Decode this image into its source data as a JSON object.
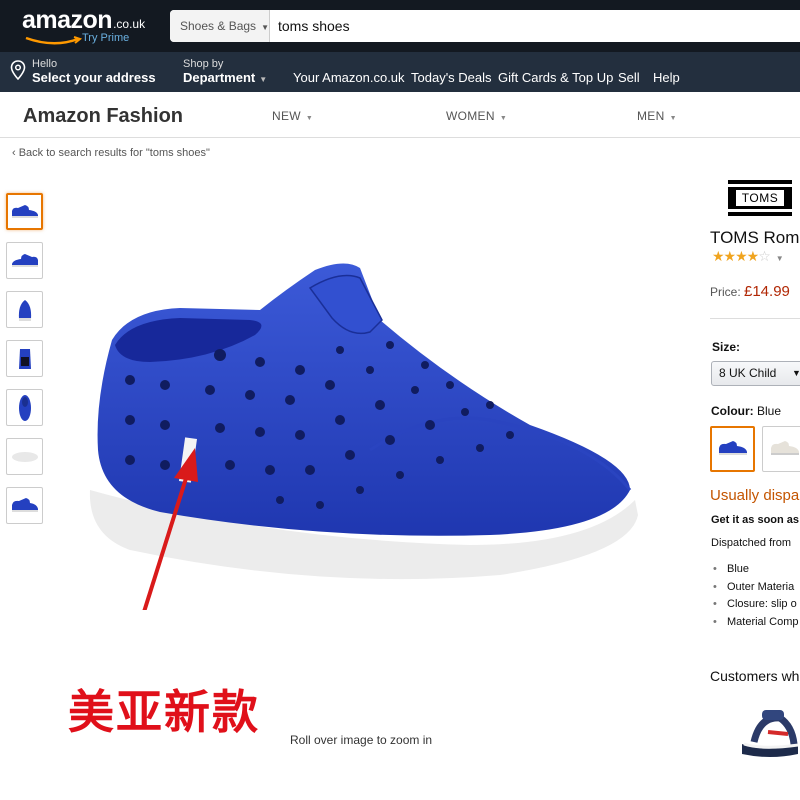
{
  "header": {
    "logo_word": "amazon",
    "logo_tld": ".co.uk",
    "logo_prime": "Try Prime",
    "search_category": "Shoes & Bags",
    "search_value": "toms shoes",
    "address_line1": "Hello",
    "address_line2": "Select your address",
    "dept_line1": "Shop by",
    "dept_line2": "Department",
    "nav": [
      "Your Amazon.co.uk",
      "Today's Deals",
      "Gift Cards & Top Up",
      "Sell",
      "Help"
    ]
  },
  "fashion": {
    "title": "Amazon Fashion",
    "nav": [
      "NEW",
      "WOMEN",
      "MEN"
    ]
  },
  "breadcrumb": "‹ Back to search results for \"toms shoes\"",
  "product": {
    "brand": "TOMS",
    "title": "TOMS Romp",
    "rating_stars": 4,
    "price_label": "Price:",
    "price": "£14.99",
    "size_label": "Size:",
    "size_value": "8 UK Child",
    "colour_label": "Colour:",
    "colour_value": "Blue",
    "availability": "Usually dispa",
    "get_it": "Get it as soon as",
    "dispatched": "Dispatched from",
    "bullets": [
      "Blue",
      "Outer Materia",
      "Closure: slip o",
      "Material Comp"
    ],
    "customers": "Customers wh",
    "zoom_hint": "Roll over image to zoom in"
  },
  "annotation": {
    "text": "美亚新款",
    "color": "#e0101a"
  },
  "colors": {
    "topbar": "#131921",
    "subbar": "#232f3e",
    "shoe_blue": "#2440c0",
    "price": "#b12704",
    "availability": "#c45500",
    "selected_border": "#e77600"
  }
}
